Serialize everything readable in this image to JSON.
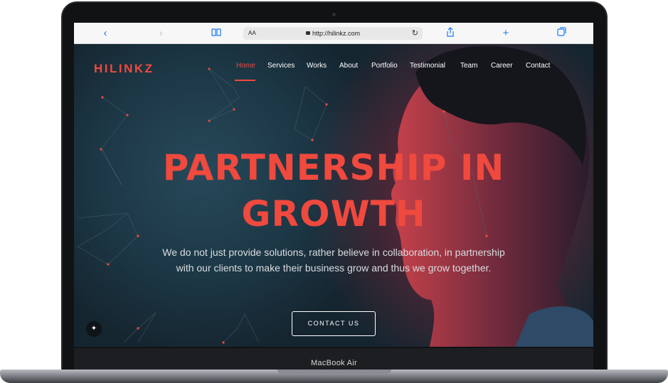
{
  "device": {
    "model_label": "MacBook Air"
  },
  "browser": {
    "url": "http://hilinkz.com",
    "text_size_label": "AA",
    "icons": [
      "back-icon",
      "forward-icon",
      "book-icon",
      "lock-icon",
      "reload-icon",
      "share-icon",
      "plus-icon",
      "tabs-icon"
    ]
  },
  "site": {
    "logo": "HILINKZ",
    "nav": [
      "Home",
      "Services",
      "Works",
      "About",
      "Portfolio",
      "Testimonial",
      "Team",
      "Career",
      "Contact"
    ],
    "active_nav": "Home",
    "headline_line1": "PARTNERSHIP IN",
    "headline_line2": "GROWTH",
    "subtext": "We do not just provide solutions, rather believe in collaboration, in partnership with our clients to make their business grow and thus we grow together.",
    "cta_label": "CONTACT US",
    "accent_color": "#f0493e"
  }
}
